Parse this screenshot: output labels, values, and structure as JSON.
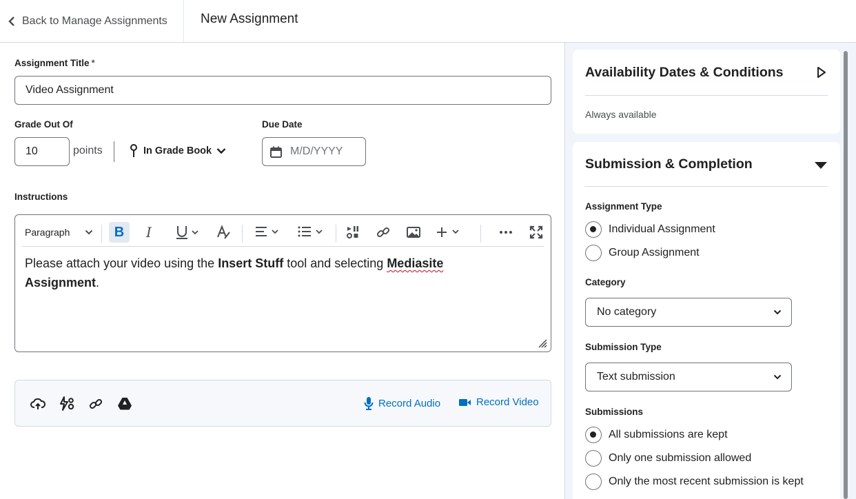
{
  "header": {
    "back_label": "Back to Manage Assignments",
    "page_title": "New Assignment"
  },
  "form": {
    "title_label": "Assignment Title",
    "title_required_mark": "*",
    "title_value": "Video Assignment",
    "grade_label": "Grade Out Of",
    "grade_value": "10",
    "points_label": "points",
    "gradebook_label": "In Grade Book",
    "due_label": "Due Date",
    "due_placeholder": "M/D/YYYY",
    "instructions_label": "Instructions"
  },
  "editor": {
    "paragraph_label": "Paragraph",
    "bold_glyph": "B",
    "italic_glyph": "I",
    "text_part1": "Please attach your video using the ",
    "text_bold1": "Insert Stuff",
    "text_part2": " tool and selecting ",
    "text_bold2a": "Mediasite",
    "text_bold2b": "Assignment",
    "text_end": "."
  },
  "attachments": {
    "record_audio": "Record Audio",
    "record_video": "Record Video"
  },
  "availability": {
    "title": "Availability Dates & Conditions",
    "summary": "Always available"
  },
  "submission": {
    "title": "Submission & Completion",
    "assignment_type_label": "Assignment Type",
    "assignment_types": [
      {
        "label": "Individual Assignment",
        "selected": true
      },
      {
        "label": "Group Assignment",
        "selected": false
      }
    ],
    "category_label": "Category",
    "category_value": "No category",
    "submission_type_label": "Submission Type",
    "submission_type_value": "Text submission",
    "submissions_label": "Submissions",
    "submission_options": [
      {
        "label": "All submissions are kept",
        "selected": true
      },
      {
        "label": "Only one submission allowed",
        "selected": false
      },
      {
        "label": "Only the most recent submission is kept",
        "selected": false
      }
    ]
  },
  "colors": {
    "accent": "#006fbf",
    "border": "#6e7477",
    "panel_bg": "#f1f5fb"
  }
}
